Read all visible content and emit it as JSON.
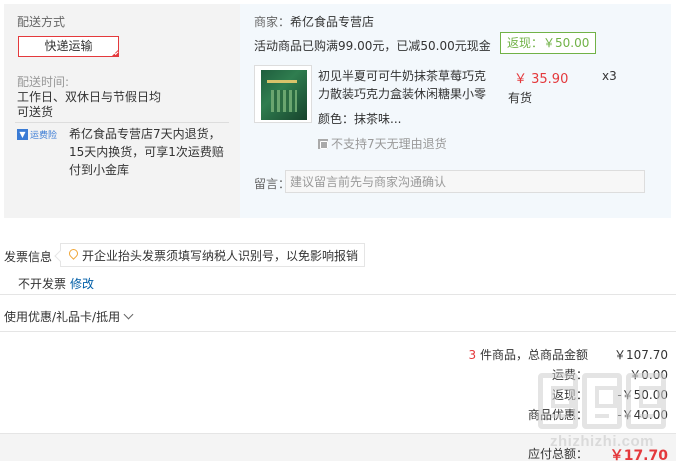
{
  "shipping": {
    "title": "配送方式",
    "method_button": "快递运输",
    "time_label": "配送时间:",
    "time_line1": "工作日、双休日与节假日均",
    "time_line2": "可送货",
    "insurance_label": "运费险",
    "return_policy": "希亿食品专营店7天内退货，15天内换货，可享1次运费赔付到小金库"
  },
  "merchant": {
    "label": "商家：",
    "name": "希亿食品专营店",
    "promo": "活动商品已购满99.00元，已减50.00元现金",
    "rebate": "返现：￥50.00"
  },
  "goods": {
    "name": "初见半夏可可牛奶抹茶草莓巧克力散装巧克力盒装休闲糖果小零",
    "color": "颜色：抹茶味...",
    "price": "￥ 35.90",
    "qty": "x3",
    "stock": "有货",
    "no_return": "不支持7天无理由退货"
  },
  "message": {
    "label": "留言：",
    "placeholder": "建议留言前先与商家沟通确认"
  },
  "invoice": {
    "title": "发票信息",
    "tip": "开企业抬头发票须填写纳税人识别号，以免影响报销",
    "type": "不开发票",
    "edit": "修改"
  },
  "coupon": {
    "label": "使用优惠/礼品卡/抵用"
  },
  "summary": {
    "count": "3",
    "count_suffix": " 件商品，总商品金额",
    "goods_total": "￥107.70",
    "shipping_label": "运费：",
    "shipping_value": "￥0.00",
    "rebate_label": "返现：",
    "rebate_value": "-￥50.00",
    "discount_label": "商品优惠：",
    "discount_value": "-￥40.00",
    "payable_label": "应付总额：",
    "payable_value": "￥17.70"
  },
  "watermark": {
    "text": "zhizhizhi.com"
  },
  "colors": {
    "accent_red": "#e4393c",
    "rebate_green": "#71b247",
    "link_blue": "#005ea7"
  }
}
